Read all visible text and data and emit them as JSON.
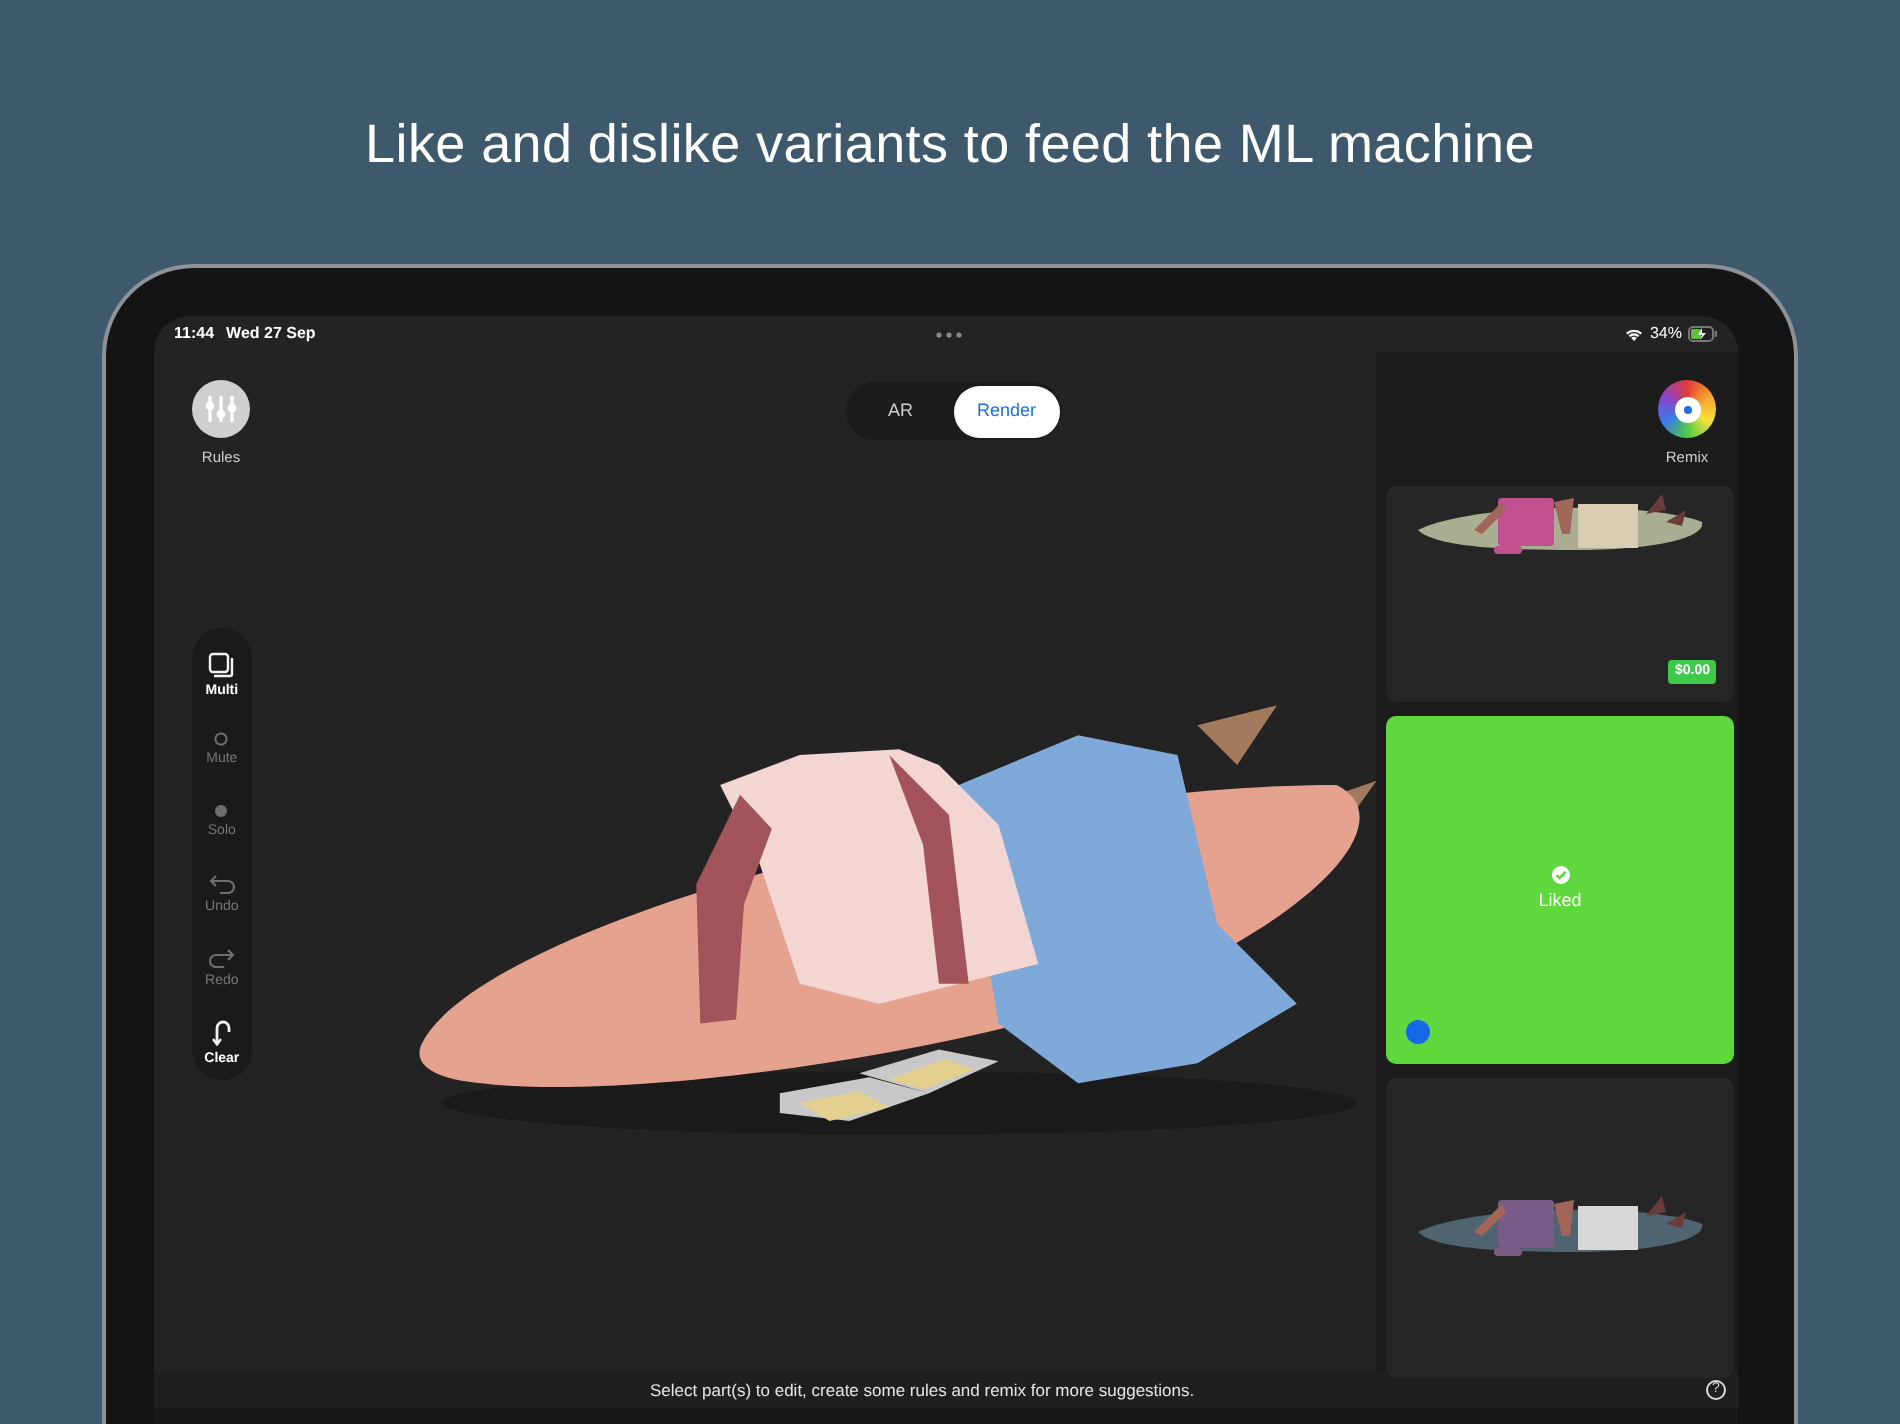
{
  "headline": "Like and dislike variants to feed the ML machine",
  "status_bar": {
    "time": "11:44",
    "date": "Wed 27 Sep",
    "battery": "34%"
  },
  "rules_button": {
    "label": "Rules"
  },
  "view_toggle": [
    {
      "label": "AR",
      "selected": false
    },
    {
      "label": "Render",
      "selected": true
    }
  ],
  "tools": [
    {
      "label": "Multi",
      "disabled": false
    },
    {
      "label": "Mute",
      "disabled": true
    },
    {
      "label": "Solo",
      "disabled": true
    },
    {
      "label": "Undo",
      "disabled": true
    },
    {
      "label": "Redo",
      "disabled": true
    },
    {
      "label": "Clear",
      "disabled": false
    }
  ],
  "remix_button": {
    "label": "Remix"
  },
  "variants": [
    {
      "liked": false,
      "selected": false,
      "price": "$0.00"
    },
    {
      "liked": true,
      "selected": true,
      "status": "Liked"
    },
    {
      "liked": false,
      "selected": false
    }
  ],
  "hint": "Select part(s) to edit, create some rules and remix for more suggestions.",
  "help_button": "?"
}
